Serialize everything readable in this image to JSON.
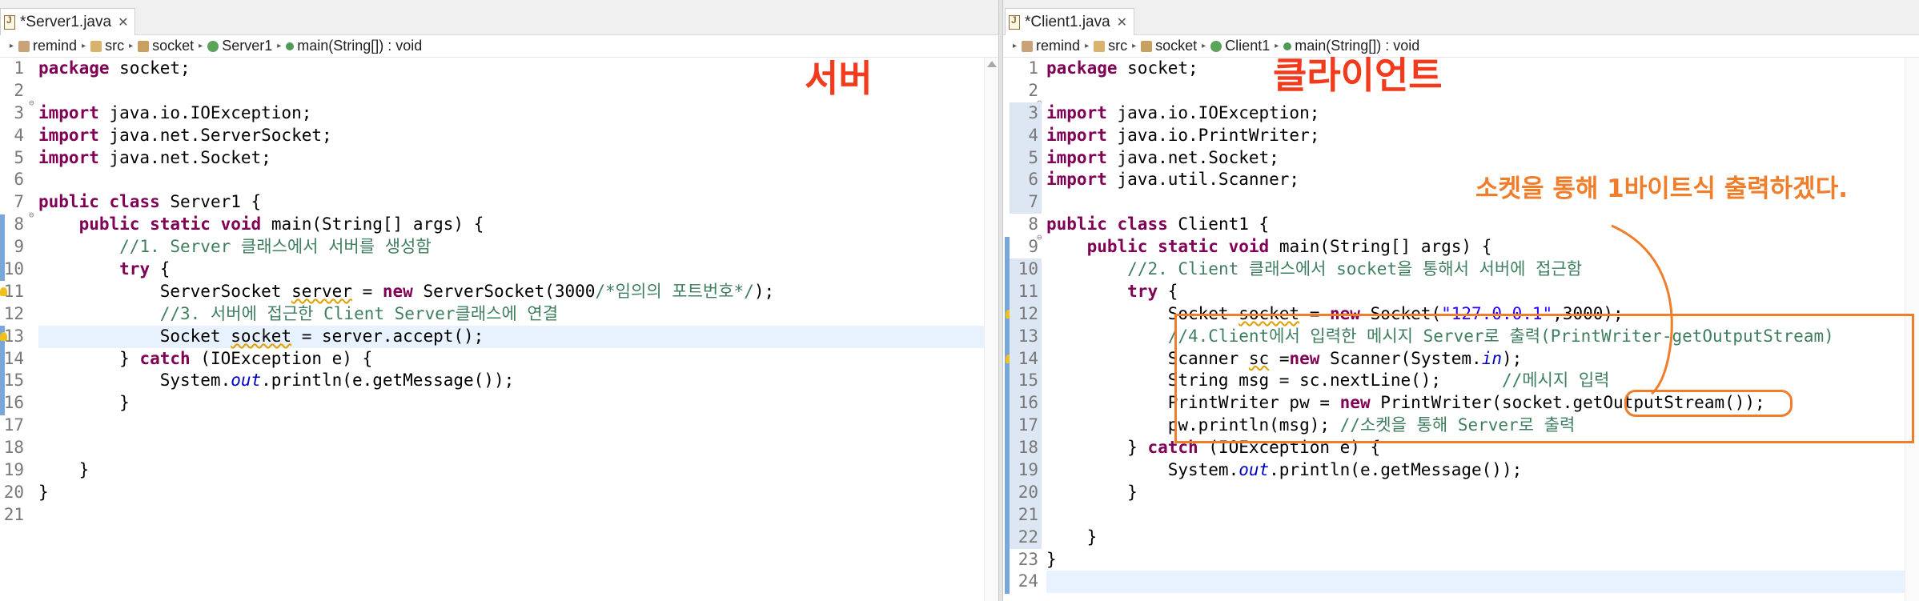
{
  "left": {
    "tab_title": "*Server1.java",
    "breadcrumb": [
      "remind",
      "src",
      "socket",
      "Server1",
      "main(String[]) : void"
    ],
    "annotation": "서버",
    "line_numbers": [
      "1",
      "2",
      "3",
      "4",
      "5",
      "6",
      "7",
      "8",
      "9",
      "10",
      "11",
      "12",
      "13",
      "14",
      "15",
      "16",
      "17",
      "18",
      "19",
      "20",
      "21"
    ]
  },
  "right": {
    "tab_title": "*Client1.java",
    "breadcrumb": [
      "remind",
      "src",
      "socket",
      "Client1",
      "main(String[]) : void"
    ],
    "annotation_title": "클라이언트",
    "annotation_note": "소켓을 통해 1바이트식 출력하겠다.",
    "line_numbers": [
      "1",
      "2",
      "3",
      "4",
      "5",
      "6",
      "7",
      "8",
      "9",
      "10",
      "11",
      "12",
      "13",
      "14",
      "15",
      "16",
      "17",
      "18",
      "19",
      "20",
      "21",
      "22",
      "23",
      "24"
    ]
  },
  "colors": {
    "keyword": "#7f0055",
    "comment": "#3f7f5f",
    "string": "#2a00ff",
    "static_field": "#0000c0",
    "annotation_red": "#f23b1d",
    "annotation_orange": "#f07d2a",
    "current_line": "#e8f2fe"
  },
  "icons": [
    "java-file-icon",
    "close-icon",
    "project-icon",
    "package-icon",
    "class-icon",
    "method-icon",
    "lightbulb-warning-icon",
    "fold-toggle-icon",
    "scroll-up-arrow-icon"
  ]
}
